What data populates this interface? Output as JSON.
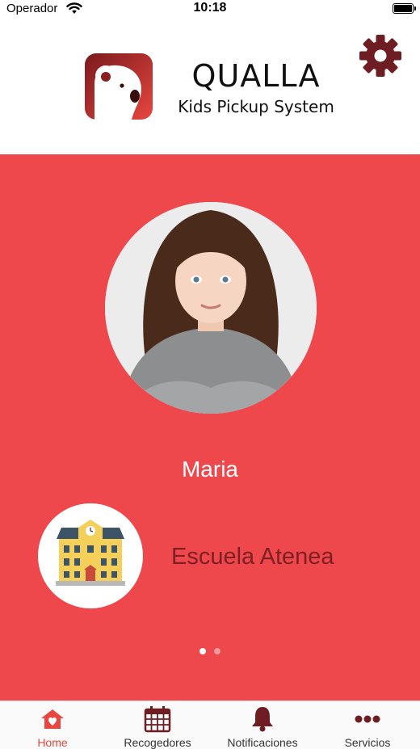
{
  "status_bar": {
    "carrier": "Operador",
    "time": "10:18"
  },
  "header": {
    "brand_title": "QUALLA",
    "brand_subtitle": "Kids Pickup System",
    "logo_icon": "koala-logo-icon",
    "settings_icon": "gear-icon"
  },
  "profile": {
    "child_name": "Maria",
    "school_name": "Escuela Atenea",
    "school_icon": "school-building-icon"
  },
  "pager": {
    "total": 2,
    "active_index": 0
  },
  "tabs": [
    {
      "label": "Home",
      "icon": "home-heart-icon",
      "active": true
    },
    {
      "label": "Recogedores",
      "icon": "calendar-icon",
      "active": false
    },
    {
      "label": "Notificaciones",
      "icon": "bell-icon",
      "active": false
    },
    {
      "label": "Servicios",
      "icon": "more-dots-icon",
      "active": false
    }
  ],
  "colors": {
    "accent_red": "#ee474c",
    "dark_red": "#7e1f22",
    "icon_maroon": "#6e1e22",
    "active_tab": "#e8463f"
  }
}
